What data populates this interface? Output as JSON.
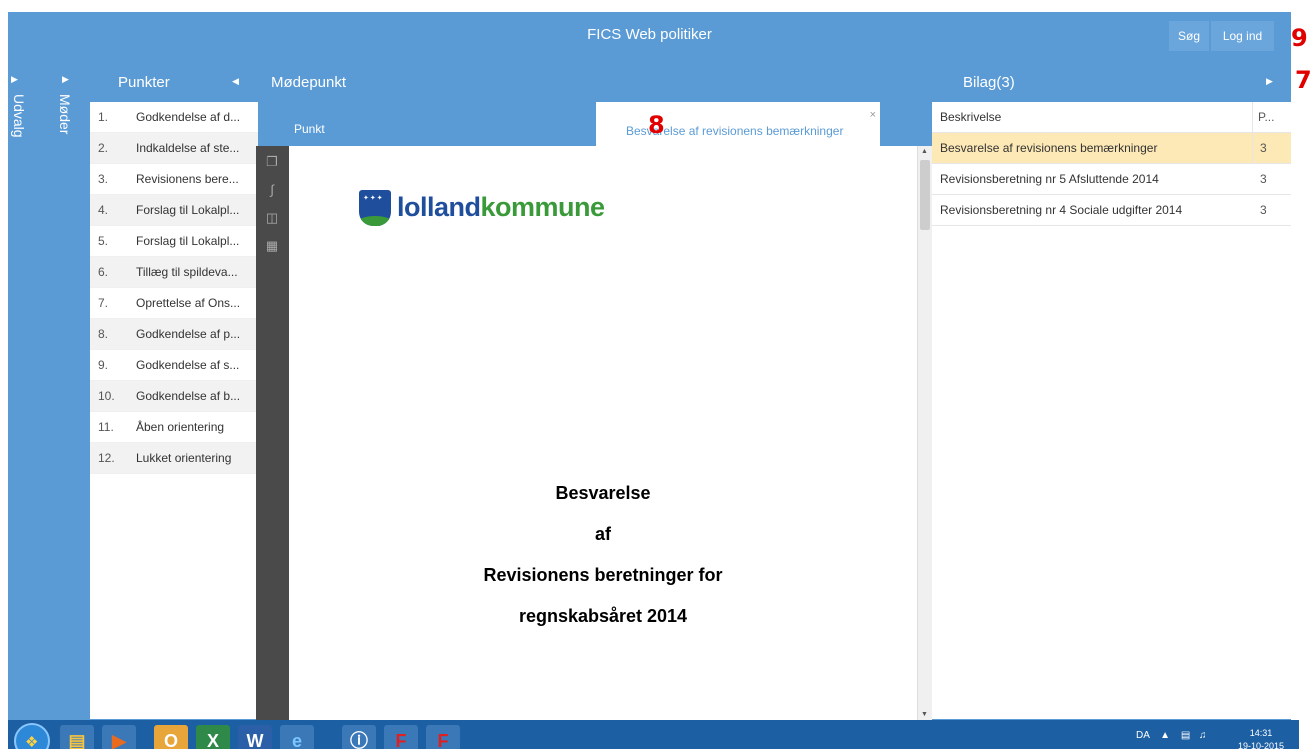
{
  "app": {
    "title": "FICS Web politiker",
    "search_label": "Søg",
    "login_label": "Log ind"
  },
  "rails": {
    "udvalg": "Udvalg",
    "moder": "Møder"
  },
  "punkter": {
    "title": "Punkter",
    "items": [
      {
        "num": "1.",
        "text": "Godkendelse af d..."
      },
      {
        "num": "2.",
        "text": "Indkaldelse af ste..."
      },
      {
        "num": "3.",
        "text": "Revisionens bere..."
      },
      {
        "num": "4.",
        "text": "Forslag til Lokalpl..."
      },
      {
        "num": "5.",
        "text": "Forslag til Lokalpl..."
      },
      {
        "num": "6.",
        "text": "Tillæg til spildeva..."
      },
      {
        "num": "7.",
        "text": "Oprettelse af Ons..."
      },
      {
        "num": "8.",
        "text": "Godkendelse af p..."
      },
      {
        "num": "9.",
        "text": "Godkendelse af s..."
      },
      {
        "num": "10.",
        "text": "Godkendelse af b..."
      },
      {
        "num": "11.",
        "text": "Åben orientering"
      },
      {
        "num": "12.",
        "text": "Lukket orientering"
      }
    ]
  },
  "modepunkt": {
    "title": "Mødepunkt",
    "tab_punkt": "Punkt",
    "tab_doc": "Besvarelse af revisionens bemærkninger",
    "tab_close": "×"
  },
  "document": {
    "logo_part1": "lolland",
    "logo_part2": "kommune",
    "lines": [
      "Besvarelse",
      "af",
      "Revisionens beretninger for",
      "regnskabsåret 2014"
    ]
  },
  "bilag": {
    "title": "Bilag(3)",
    "col_desc": "Beskrivelse",
    "col_page": "P...",
    "rows": [
      {
        "desc": "Besvarelse af revisionens bemærkninger",
        "page": "3",
        "selected": true
      },
      {
        "desc": "Revisionsberetning nr 5 Afsluttende 2014",
        "page": "3",
        "selected": false
      },
      {
        "desc": "Revisionsberetning nr 4 Sociale udgifter 2014",
        "page": "3",
        "selected": false
      }
    ]
  },
  "annotations": {
    "a9": "9",
    "a7": "7",
    "a8": "8"
  },
  "taskbar": {
    "lang": "DA",
    "time": "14:31",
    "date": "19-10-2015"
  },
  "colors": {
    "accent": "#5b9bd5",
    "selected_row": "#fde9b6",
    "annotation": "#e00000"
  }
}
